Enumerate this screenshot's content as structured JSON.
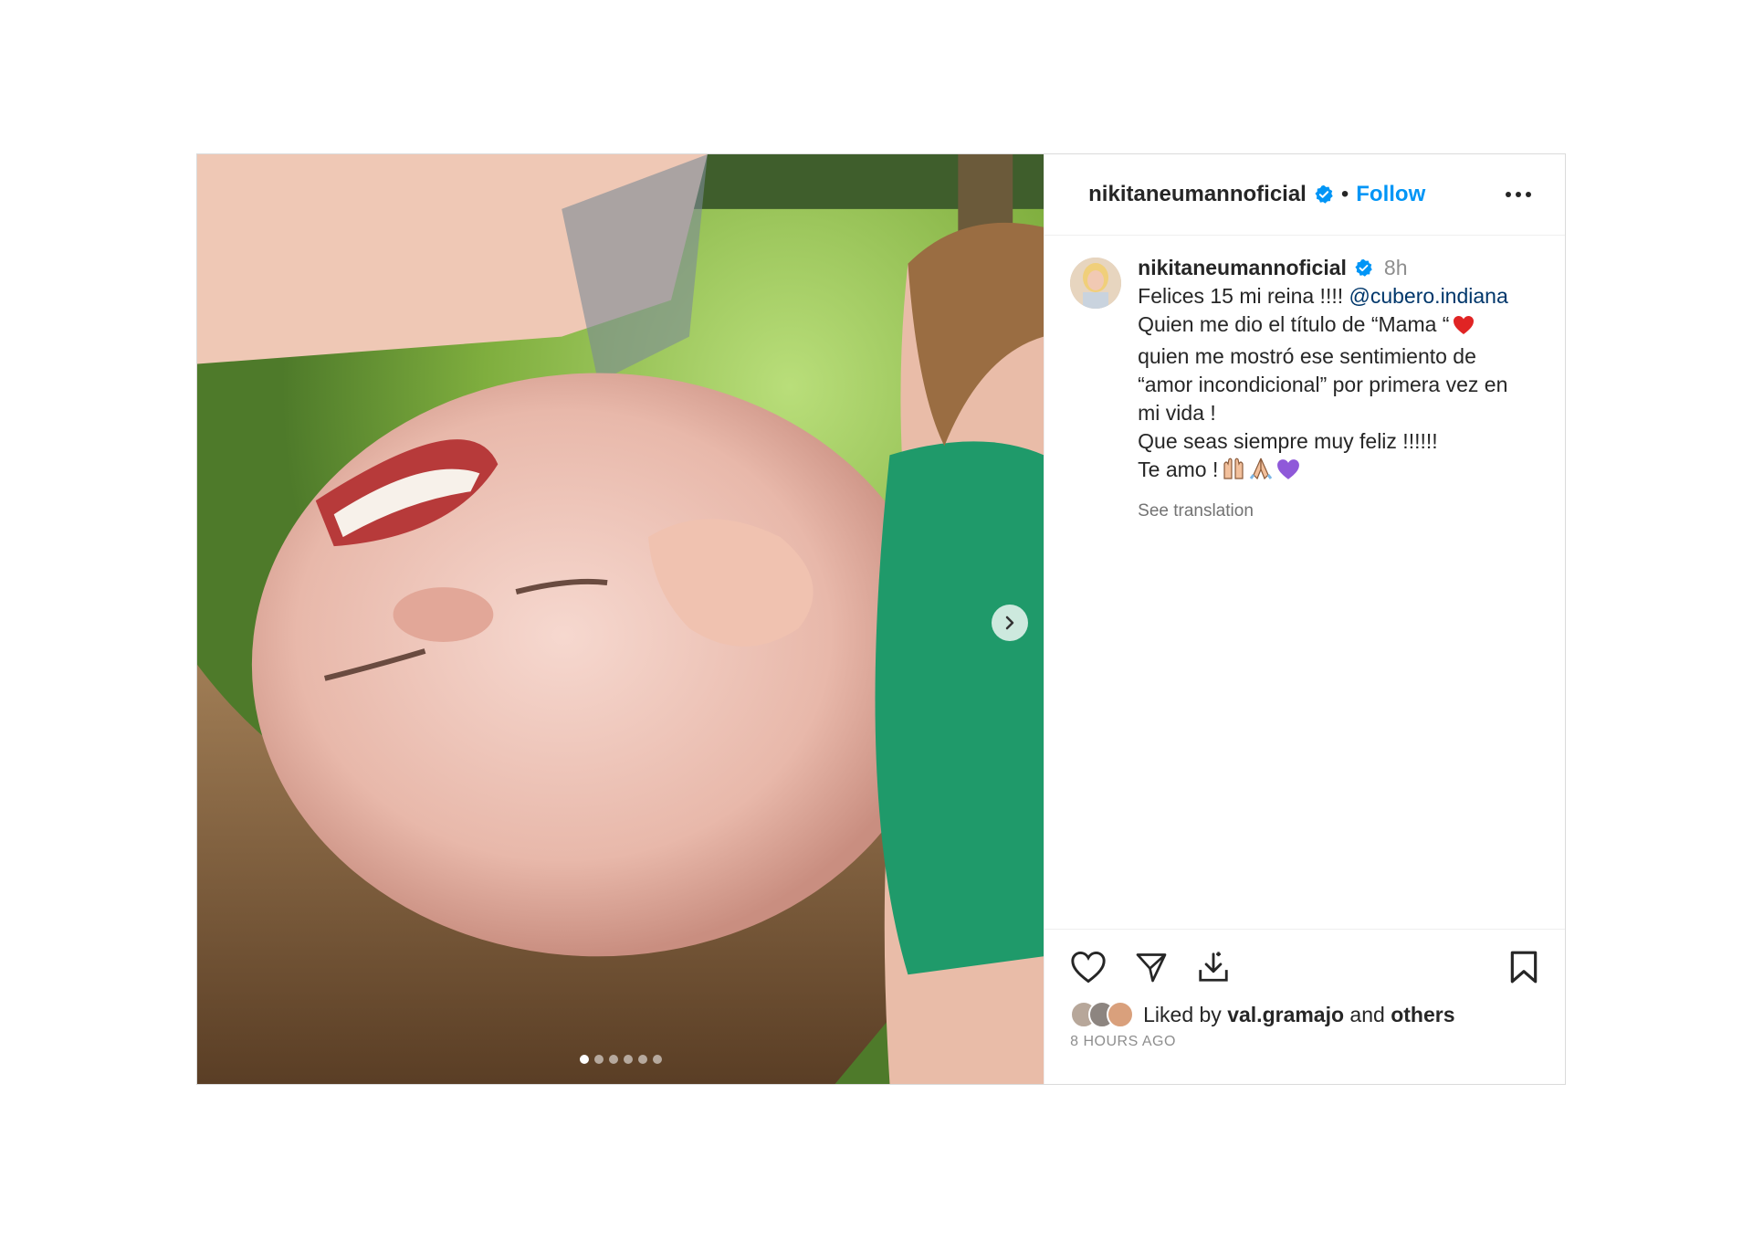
{
  "post": {
    "username": "nikitaneumannoficial",
    "separator": "•",
    "follow_label": "Follow",
    "media": {
      "slide_count": 6,
      "current_slide": 1
    },
    "caption": {
      "username": "nikitaneumannoficial",
      "time": "8h",
      "line1_text": "Felices 15 mi reina !!!! ",
      "mention": "@cubero.indiana",
      "line2_text": "Quien me dio el título de “Mama “",
      "line3_text": "quien me mostró ese sentimiento de",
      "line4_text": "“amor incondicional” por primera vez en",
      "line5_text": "mi vida !",
      "line6_text": "Que seas siempre muy feliz !!!!!!",
      "line7_text": "Te amo !",
      "see_translation": "See translation"
    },
    "likes": {
      "prefix": "Liked by ",
      "user": "val.gramajo",
      "middle": " and ",
      "others": "others"
    },
    "time_ago": "8 HOURS AGO",
    "icons": {
      "verified": "verified-badge-icon",
      "more": "more-options-icon",
      "like": "heart-icon",
      "share": "send-icon",
      "save_download": "download-icon",
      "bookmark": "bookmark-icon",
      "next": "chevron-right-icon"
    },
    "colors": {
      "follow": "#0095f6",
      "verified": "#0095f6",
      "mention": "#00376b",
      "heart_emoji": "#e02424",
      "purple_heart": "#8f59d9"
    }
  }
}
